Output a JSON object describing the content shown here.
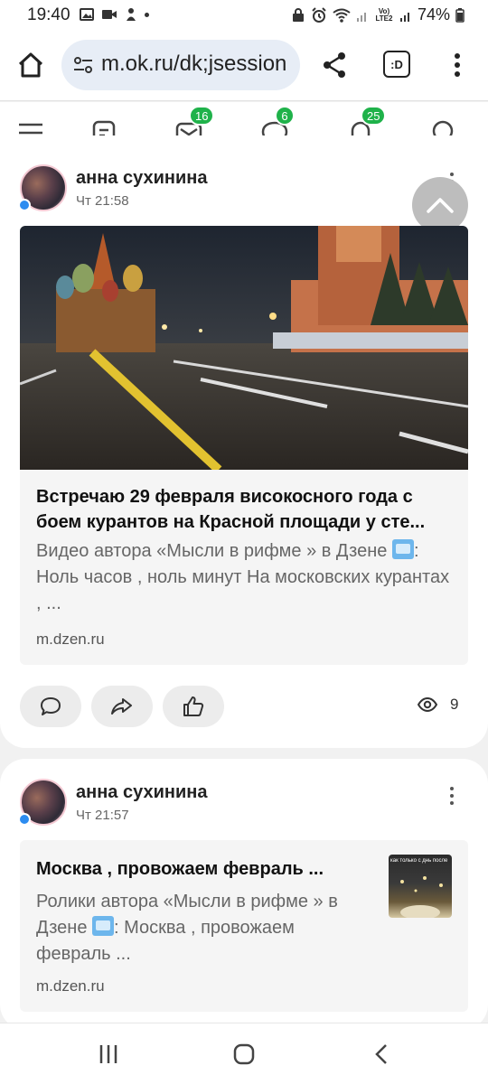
{
  "status_bar": {
    "time": "19:40",
    "network_label": "Vo) LTE2",
    "battery": "74%"
  },
  "browser": {
    "url": "m.ok.ru/dk;jsession",
    "tab_label": ":D"
  },
  "app_nav": {
    "messages_badge": "16",
    "discussions_badge": "6",
    "notifications_badge": "25"
  },
  "posts": [
    {
      "author": "анна сухинина",
      "time": "Чт 21:58",
      "title": "Встречаю 29 февраля високосного года с боем курантов на Красной площади у сте...",
      "description_before": "Видео автора «Мысли в рифме » в Дзене",
      "description_after": ": Ноль часов , ноль минут На московских курантах , ...",
      "domain": "m.dzen.ru",
      "views": "9"
    },
    {
      "author": "анна сухинина",
      "time": "Чт 21:57",
      "title": "Москва , провожаем февраль ...",
      "description_before": "Ролики автора «Мысли в рифме » в Дзене",
      "description_after": ": Москва , провожаем февраль ...",
      "domain": "m.dzen.ru",
      "thumb_caption": "как только с днь после"
    }
  ],
  "colors": {
    "badge": "#1fb24a",
    "online_dot": "#2c8cf0",
    "url_bar": "#e7edf6"
  }
}
